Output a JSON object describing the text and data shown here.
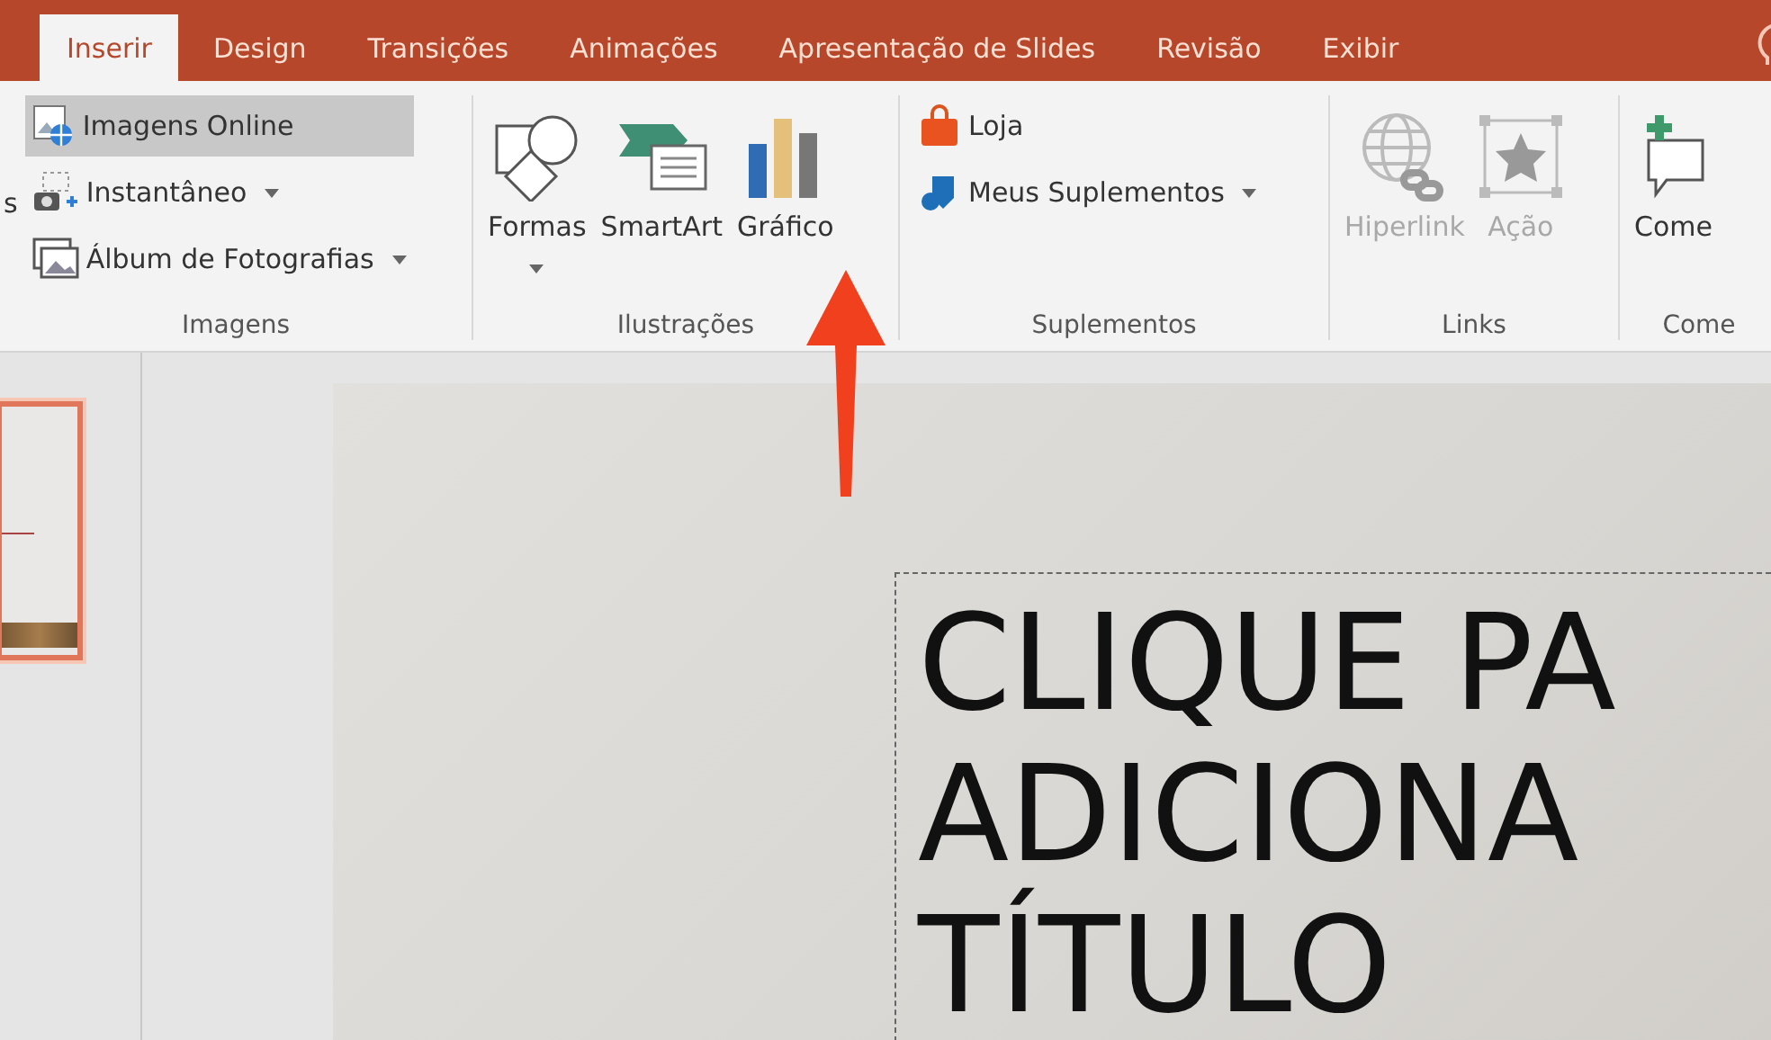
{
  "tabs": [
    {
      "label": "Inserir",
      "selected": true
    },
    {
      "label": "Design",
      "selected": false
    },
    {
      "label": "Transições",
      "selected": false
    },
    {
      "label": "Animações",
      "selected": false
    },
    {
      "label": "Apresentação de Slides",
      "selected": false
    },
    {
      "label": "Revisão",
      "selected": false
    },
    {
      "label": "Exibir",
      "selected": false
    }
  ],
  "groups": [
    {
      "label": "Imagens",
      "items": [
        {
          "kind": "fragment",
          "label": "s"
        },
        {
          "kind": "small",
          "label": "Imagens Online",
          "highlighted": true,
          "dropdown": false
        },
        {
          "kind": "small",
          "label": "Instantâneo",
          "highlighted": false,
          "dropdown": true
        },
        {
          "kind": "small",
          "label": "Álbum de Fotografias",
          "highlighted": false,
          "dropdown": true
        }
      ]
    },
    {
      "label": "Ilustrações",
      "items": [
        {
          "kind": "large",
          "label": "Formas",
          "disabled": false,
          "dropdown": true
        },
        {
          "kind": "large",
          "label": "SmartArt",
          "disabled": false,
          "dropdown": false
        },
        {
          "kind": "large",
          "label": "Gráfico",
          "disabled": false,
          "dropdown": false
        }
      ]
    },
    {
      "label": "Suplementos",
      "items": [
        {
          "kind": "small",
          "label": "Loja",
          "highlighted": false,
          "dropdown": false
        },
        {
          "kind": "small",
          "label": "Meus Suplementos",
          "highlighted": false,
          "dropdown": true
        }
      ]
    },
    {
      "label": "Links",
      "items": [
        {
          "kind": "large",
          "label": "Hiperlink",
          "disabled": true,
          "dropdown": false
        },
        {
          "kind": "large",
          "label": "Ação",
          "disabled": true,
          "dropdown": false
        }
      ]
    },
    {
      "label": "Come",
      "items": [
        {
          "kind": "large",
          "label": "Come",
          "disabled": false,
          "dropdown": false
        }
      ]
    }
  ],
  "thumbnails": [
    {
      "selected": true
    }
  ],
  "slide": {
    "title_lines": [
      "CLIQUE PA",
      "ADICIONA",
      "TÍTULO"
    ]
  }
}
